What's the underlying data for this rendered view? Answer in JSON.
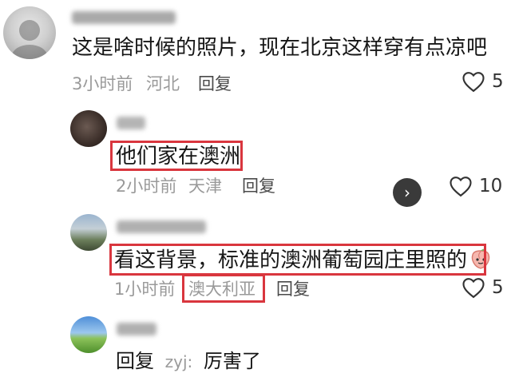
{
  "comments": [
    {
      "text": "这是啥时候的照片，现在北京这样穿有点凉吧",
      "time": "3小时前",
      "location": "河北",
      "reply_label": "回复",
      "likes": "5"
    },
    {
      "text": "他们家在澳洲",
      "time": "2小时前",
      "location": "天津",
      "reply_label": "回复",
      "likes": "10"
    },
    {
      "text": "看这背景，标准的澳洲葡萄园庄里照的",
      "time": "1小时前",
      "location": "澳大利亚",
      "reply_label": "回复",
      "likes": "5"
    },
    {
      "reply_label": "回复",
      "mention": "zyj:",
      "text": "厉害了"
    }
  ],
  "icons": {
    "like": "heart-outline-icon",
    "next": "chevron-right-icon",
    "emoji": "peach-emoji-icon"
  },
  "colors": {
    "highlight": "#d9363e",
    "meta_text": "#9a9a9a"
  }
}
